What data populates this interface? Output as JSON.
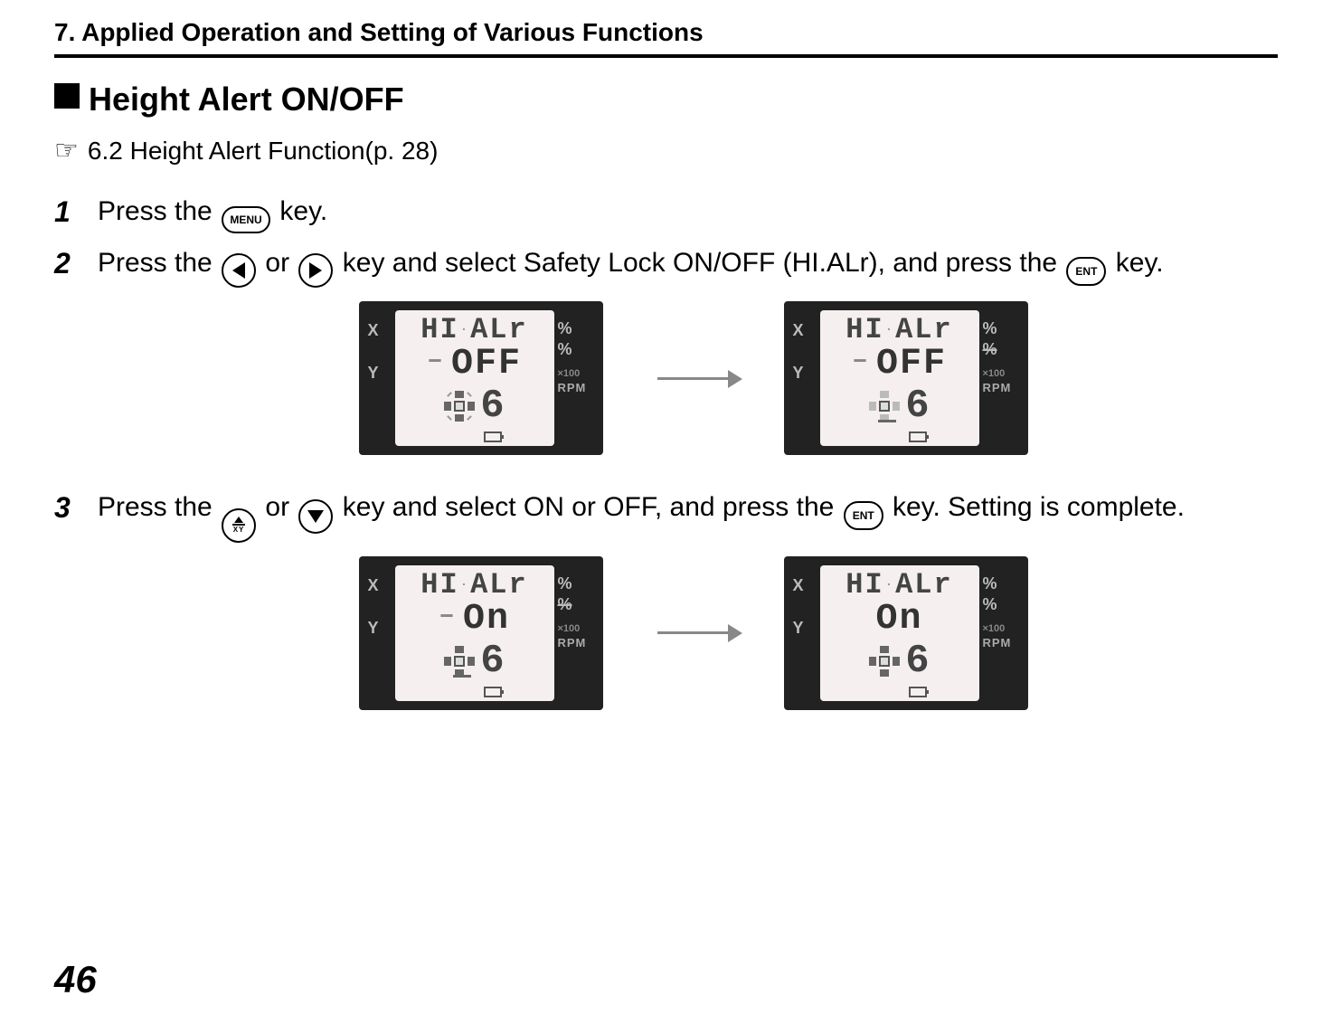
{
  "chapter": "7.  Applied Operation and Setting of Various Functions",
  "section_title": "Height Alert ON/OFF",
  "crossref": "6.2 Height Alert Function(p. 28)",
  "steps": {
    "s1": {
      "num": "1",
      "pre": "Press the ",
      "post": " key."
    },
    "s2": {
      "num": "2",
      "pre": "Press the ",
      "mid1": " or ",
      "mid2": " key and select Safety Lock ON/OFF (HI.ALr), and press the ",
      "post": " key."
    },
    "s3": {
      "num": "3",
      "pre": "Press the ",
      "mid1": " or ",
      "mid2": " key and select ON or OFF, and press the ",
      "post": " key. Setting is complete."
    }
  },
  "keys": {
    "menu": "MENU",
    "ent": "ENT"
  },
  "screen_labels": {
    "x": "X",
    "y": "Y",
    "pct": "%",
    "x100": "×100",
    "rpm": "RPM"
  },
  "screens": {
    "row1a": {
      "line1": "HI.ALr",
      "line2": "OFF",
      "digit": "6"
    },
    "row1b": {
      "line1": "HI.ALr",
      "line2": "OFF",
      "digit": "6"
    },
    "row2a": {
      "line1": "HI.ALr",
      "line2": "On",
      "digit": "6"
    },
    "row2b": {
      "line1": "HI.ALr",
      "line2": "On",
      "digit": "6"
    }
  },
  "page_number": "46"
}
